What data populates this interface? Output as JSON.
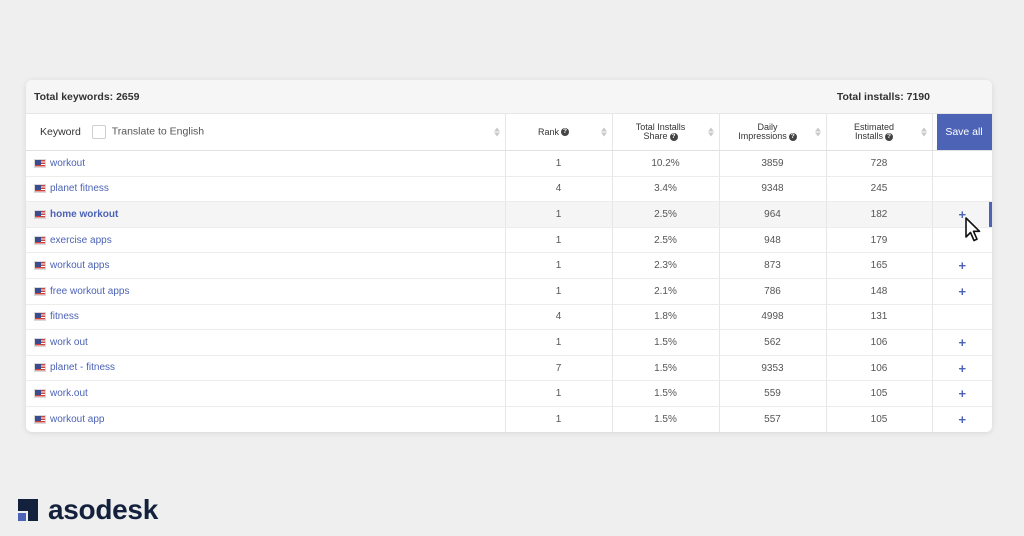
{
  "summary": {
    "total_keywords": "Total keywords: 2659",
    "total_installs": "Total installs: 7190"
  },
  "header": {
    "keyword": "Keyword",
    "translate": "Translate to English",
    "rank": "Rank",
    "share_line1": "Total Installs",
    "share_line2": "Share",
    "impressions_line1": "Daily",
    "impressions_line2": "Impressions",
    "estimated_line1": "Estimated",
    "estimated_line2": "Installs",
    "save_all": "Save all"
  },
  "rows": [
    {
      "keyword": "workout",
      "rank": "1",
      "share": "10.2%",
      "impressions": "3859",
      "installs": "728",
      "action": ""
    },
    {
      "keyword": "planet fitness",
      "rank": "4",
      "share": "3.4%",
      "impressions": "9348",
      "installs": "245",
      "action": ""
    },
    {
      "keyword": "home workout",
      "rank": "1",
      "share": "2.5%",
      "impressions": "964",
      "installs": "182",
      "action": "+"
    },
    {
      "keyword": "exercise apps",
      "rank": "1",
      "share": "2.5%",
      "impressions": "948",
      "installs": "179",
      "action": ""
    },
    {
      "keyword": "workout apps",
      "rank": "1",
      "share": "2.3%",
      "impressions": "873",
      "installs": "165",
      "action": "+"
    },
    {
      "keyword": "free workout apps",
      "rank": "1",
      "share": "2.1%",
      "impressions": "786",
      "installs": "148",
      "action": "+"
    },
    {
      "keyword": "fitness",
      "rank": "4",
      "share": "1.8%",
      "impressions": "4998",
      "installs": "131",
      "action": ""
    },
    {
      "keyword": "work out",
      "rank": "1",
      "share": "1.5%",
      "impressions": "562",
      "installs": "106",
      "action": "+"
    },
    {
      "keyword": "planet - fitness",
      "rank": "7",
      "share": "1.5%",
      "impressions": "9353",
      "installs": "106",
      "action": "+"
    },
    {
      "keyword": "work.out",
      "rank": "1",
      "share": "1.5%",
      "impressions": "559",
      "installs": "105",
      "action": "+"
    },
    {
      "keyword": "workout app",
      "rank": "1",
      "share": "1.5%",
      "impressions": "557",
      "installs": "105",
      "action": "+"
    }
  ],
  "icons": {
    "flag": "us-flag-icon",
    "help": "question-circle-icon",
    "add": "plus-icon",
    "sort": "sort-arrows-icon",
    "cursor": "mouse-pointer-icon"
  },
  "colors": {
    "accent": "#4c63b6",
    "brand_dark": "#14213d",
    "background": "#efefef"
  },
  "brand": {
    "name": "asodesk"
  }
}
